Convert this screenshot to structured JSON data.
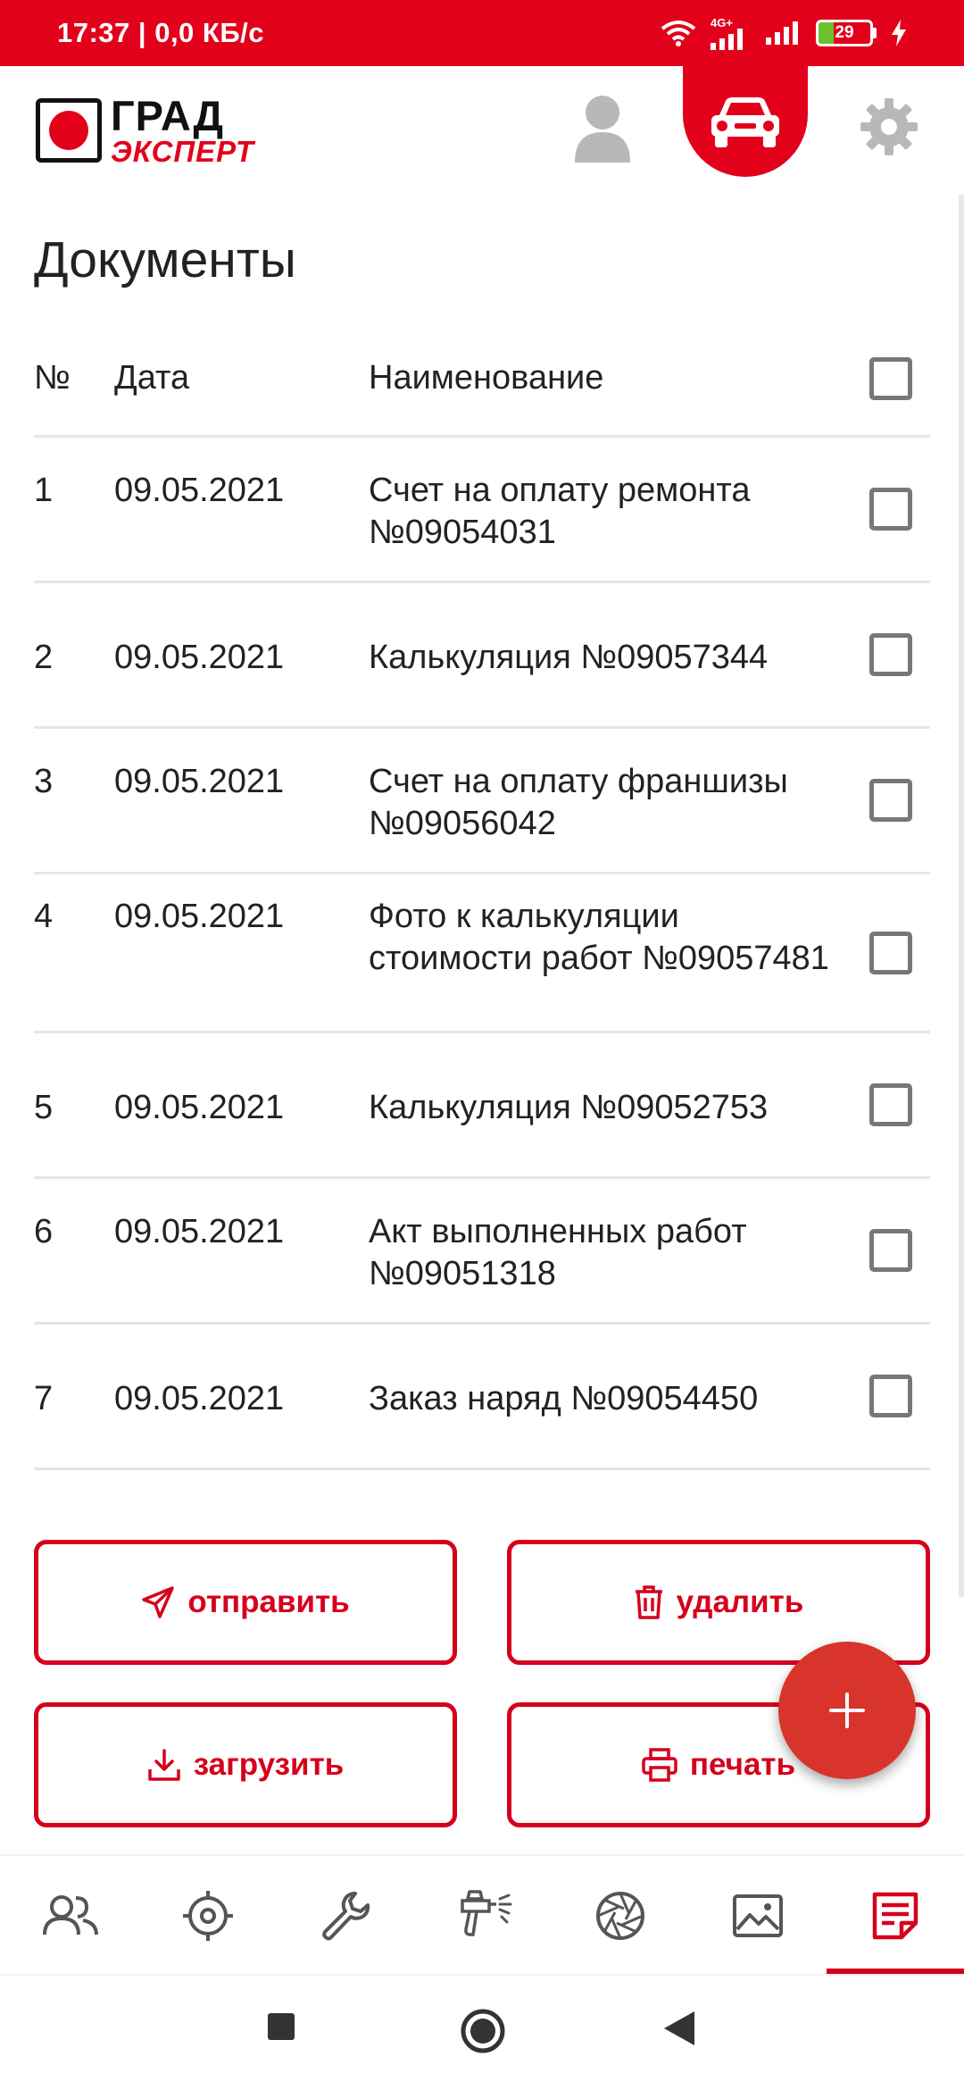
{
  "status_bar": {
    "time": "17:37",
    "net_speed": "0,0 КБ/с",
    "battery": "29",
    "network": "4G+"
  },
  "header": {
    "logo_line1": "ГРАД",
    "logo_line2": "ЭКСПЕРТ",
    "accent_color": "#e3001b"
  },
  "page": {
    "title": "Документы"
  },
  "table": {
    "headers": {
      "num": "№",
      "date": "Дата",
      "name": "Наименование"
    },
    "rows": [
      {
        "num": "1",
        "date": "09.05.2021",
        "name": "Счет на оплату ремонта №09054031",
        "checked": false
      },
      {
        "num": "2",
        "date": "09.05.2021",
        "name": "Калькуляция №09057344",
        "checked": false
      },
      {
        "num": "3",
        "date": "09.05.2021",
        "name": "Счет на оплату франшизы №09056042",
        "checked": false
      },
      {
        "num": "4",
        "date": "09.05.2021",
        "name": "Фото к калькуляции стоимости работ №09057481",
        "checked": false
      },
      {
        "num": "5",
        "date": "09.05.2021",
        "name": "Калькуляция №09052753",
        "checked": false
      },
      {
        "num": "6",
        "date": "09.05.2021",
        "name": "Акт выполненных работ №09051318",
        "checked": false
      },
      {
        "num": "7",
        "date": "09.05.2021",
        "name": "Заказ наряд №09054450",
        "checked": false
      }
    ]
  },
  "actions": {
    "send": "отправить",
    "delete": "удалить",
    "upload": "загрузить",
    "print": "печать"
  },
  "icons": {
    "header": [
      "user-icon",
      "car-icon",
      "gear-icon"
    ],
    "bottom_nav": [
      "people-icon",
      "target-icon",
      "wrench-icon",
      "spray-gun-icon",
      "aperture-icon",
      "image-icon",
      "document-icon"
    ]
  }
}
